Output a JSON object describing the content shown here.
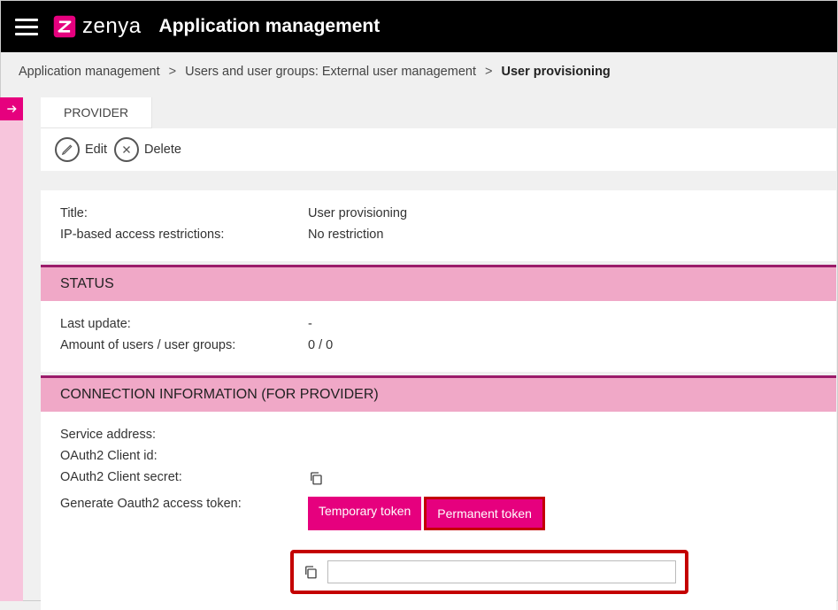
{
  "header": {
    "brand": "zenya",
    "app_title": "Application management"
  },
  "breadcrumb": {
    "items": [
      "Application management",
      "Users and user groups: External user management"
    ],
    "current": "User provisioning"
  },
  "tab": {
    "label": "PROVIDER"
  },
  "toolbar": {
    "edit": "Edit",
    "delete": "Delete"
  },
  "details": {
    "title_label": "Title:",
    "title_value": "User provisioning",
    "ip_label": "IP-based access restrictions:",
    "ip_value": "No restriction"
  },
  "status": {
    "heading": "STATUS",
    "last_update_label": "Last update:",
    "last_update_value": "-",
    "count_label": "Amount of users / user groups:",
    "count_value": "0 / 0"
  },
  "conn": {
    "heading": "CONNECTION INFORMATION (FOR PROVIDER)",
    "service_label": "Service address:",
    "client_id_label": "OAuth2 Client id:",
    "client_secret_label": "OAuth2 Client secret:",
    "gen_label": "Generate Oauth2 access token:",
    "temp_btn": "Temporary token",
    "perm_btn": "Permanent token",
    "token_value": ""
  }
}
